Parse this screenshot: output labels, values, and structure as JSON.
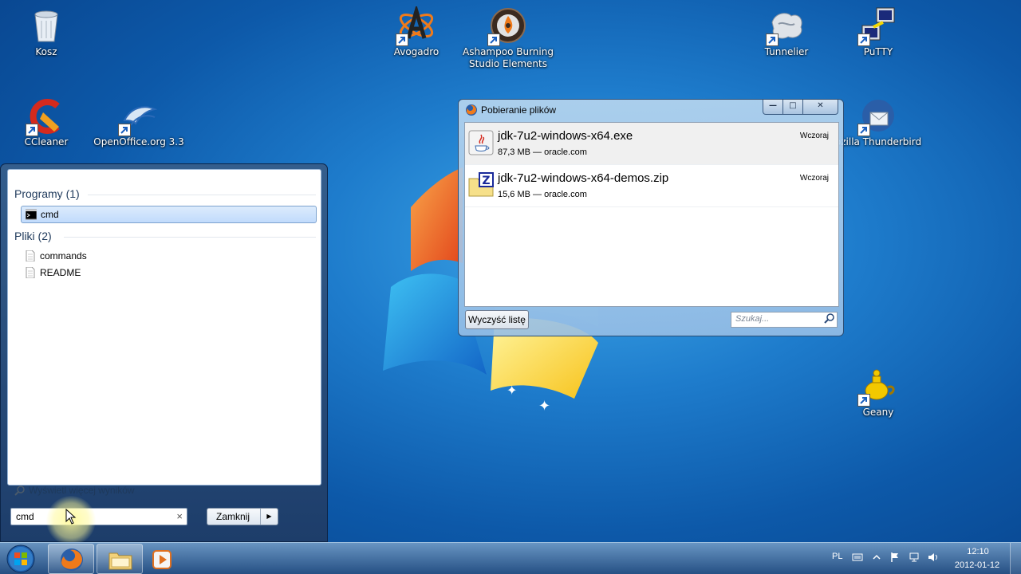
{
  "desktop": {
    "icons": [
      {
        "label": "Kosz",
        "icon": "recycle-bin-icon"
      },
      {
        "label": "Avogadro",
        "icon": "avogadro-icon"
      },
      {
        "label": "Ashampoo Burning Studio Elements",
        "icon": "ashampoo-icon"
      },
      {
        "label": "Tunnelier",
        "icon": "tunnelier-icon"
      },
      {
        "label": "PuTTY",
        "icon": "putty-icon"
      },
      {
        "label": "CCleaner",
        "icon": "ccleaner-icon"
      },
      {
        "label": "OpenOffice.org 3.3",
        "icon": "openoffice-icon"
      },
      {
        "label": "ozilla Thunderbird",
        "icon": "thunderbird-icon"
      },
      {
        "label": "Geany",
        "icon": "geany-icon"
      }
    ]
  },
  "start_menu": {
    "programs_header": "Programy (1)",
    "programs": [
      {
        "label": "cmd",
        "icon": "cmd-icon",
        "selected": true
      }
    ],
    "files_header": "Pliki (2)",
    "files": [
      {
        "label": "commands",
        "icon": "document-icon"
      },
      {
        "label": "README",
        "icon": "document-icon"
      }
    ],
    "more_results": "Wyświetl więcej wyników",
    "search_value": "cmd",
    "clear_glyph": "×",
    "shutdown_label": "Zamknij",
    "shutdown_arrow": "▶"
  },
  "downloads_window": {
    "title": "Pobieranie plików",
    "controls": {
      "minimize": "—",
      "maximize": "□",
      "close": "✕"
    },
    "items": [
      {
        "name": "jdk-7u2-windows-x64.exe",
        "meta": "87,3 MB — oracle.com",
        "time": "Wczoraj",
        "icon": "java-icon"
      },
      {
        "name": "jdk-7u2-windows-x64-demos.zip",
        "meta": "15,6 MB — oracle.com",
        "time": "Wczoraj",
        "icon": "zip-icon"
      }
    ],
    "clear_list": "Wyczyść listę",
    "search_placeholder": "Szukaj..."
  },
  "taskbar": {
    "pinned": [
      {
        "name": "firefox-icon"
      },
      {
        "name": "explorer-icon"
      },
      {
        "name": "media-player-icon"
      }
    ],
    "language": "PL",
    "time": "12:10",
    "date": "2012-01-12"
  }
}
